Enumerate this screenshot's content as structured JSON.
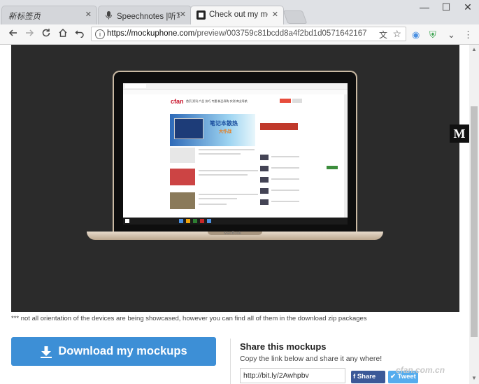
{
  "browser": {
    "tabs": [
      {
        "label": "新标签页",
        "active": false
      },
      {
        "label": "Speechnotes |听写记事本",
        "active": false
      },
      {
        "label": "Check out my mockup o",
        "active": true
      }
    ],
    "window_controls": {
      "minimize": "—",
      "maximize": "☐",
      "close": "✕"
    },
    "url_host": "https://mockuphone.com",
    "url_path": "/preview/003759c81bcdd8a4f2bd1d0571642167"
  },
  "page": {
    "medium_badge": "M",
    "disclaimer": "*** not all orientation of the devices are being showcased, however you can find all of them in the download zip packages",
    "download_label": "Download my mockups",
    "share": {
      "title": "Share this mockups",
      "subtitle": "Copy the link below and share it any where!",
      "link": "http://bit.ly/2Awhpbv",
      "facebook_label": "Share",
      "twitter_label": "Tweet"
    },
    "watermark": "cfan.com.cn"
  },
  "mockup": {
    "device_label": "MacBook",
    "screen": {
      "logo": "cfan",
      "nav": "首页  资讯  产品  技巧  专题  新品导购  实测  商业导航",
      "banner_title": "笔记本散热",
      "banner_sub": "大作战"
    }
  },
  "colors": {
    "download_button": "#3d8fd6",
    "facebook": "#3b5998",
    "twitter": "#55acee",
    "stage": "#2b2b2b"
  }
}
